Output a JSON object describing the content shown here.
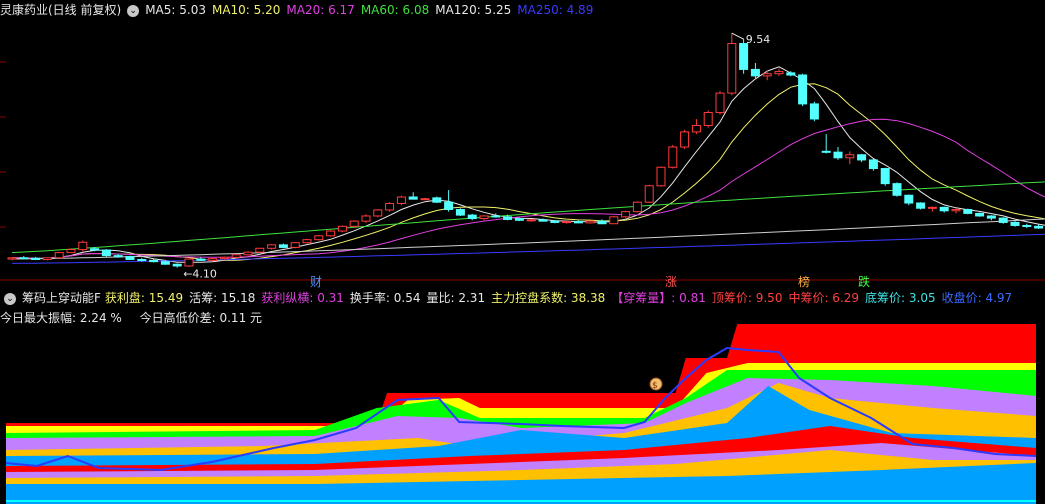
{
  "header": {
    "title": "灵康药业(日线 前复权)",
    "ma": [
      {
        "label": "MA5: 5.03",
        "color": "#e8e8e8"
      },
      {
        "label": "MA10: 5.20",
        "color": "#f2f26a"
      },
      {
        "label": "MA20: 6.17",
        "color": "#e040e0"
      },
      {
        "label": "MA60: 6.08",
        "color": "#40e040"
      },
      {
        "label": "MA120: 5.25",
        "color": "#e8e8e8"
      },
      {
        "label": "MA250: 4.89",
        "color": "#3a3aff"
      }
    ]
  },
  "price_labels": {
    "high": "9.54",
    "low": "4.10"
  },
  "markers": [
    {
      "text": "财",
      "color": "#4f8fff"
    },
    {
      "text": "涨",
      "color": "#ff5050"
    },
    {
      "text": "榜",
      "color": "#ffb040"
    },
    {
      "text": "跌",
      "color": "#40ff40"
    }
  ],
  "indicator": {
    "name": "筹码上穿动能F",
    "items": [
      {
        "label": "获利盘: 15.49",
        "color": "#f2f26a"
      },
      {
        "label": "活筹: 15.18",
        "color": "#e8e8e8"
      },
      {
        "label": "获利纵横: 0.31",
        "color": "#e040e0"
      },
      {
        "label": "换手率: 0.54",
        "color": "#e8e8e8"
      },
      {
        "label": "量比: 2.31",
        "color": "#e8e8e8"
      },
      {
        "label": "主力控盘系数: 38.38",
        "color": "#f2f26a"
      },
      {
        "label": "【穿筹量】: 0.81",
        "color": "#e040e0"
      },
      {
        "label": "顶筹价: 9.50",
        "color": "#ff4040"
      },
      {
        "label": "中筹价: 6.29",
        "color": "#ff4040"
      },
      {
        "label": "底筹价: 3.05",
        "color": "#40e0e0"
      },
      {
        "label": "收盘价: 4.97",
        "color": "#3a6aff"
      }
    ]
  },
  "amplitude": {
    "max_amp": "今日最大振幅: 2.24 %",
    "hl_diff": "今日高低价差: 0.11 元"
  },
  "colors": {
    "up": "#ff3b3b",
    "down": "#54ffff",
    "bg": "#000000",
    "grid": "#8b0000"
  },
  "chart_data": {
    "type": "candlestick",
    "candles": [
      [
        4.3,
        4.34,
        4.27,
        4.33
      ],
      [
        4.33,
        4.37,
        4.3,
        4.32
      ],
      [
        4.32,
        4.35,
        4.28,
        4.29
      ],
      [
        4.29,
        4.34,
        4.27,
        4.33
      ],
      [
        4.33,
        4.47,
        4.32,
        4.45
      ],
      [
        4.45,
        4.55,
        4.44,
        4.52
      ],
      [
        4.52,
        4.73,
        4.48,
        4.69
      ],
      [
        4.54,
        4.58,
        4.48,
        4.51
      ],
      [
        4.51,
        4.53,
        4.35,
        4.38
      ],
      [
        4.38,
        4.42,
        4.33,
        4.36
      ],
      [
        4.36,
        4.38,
        4.28,
        4.29
      ],
      [
        4.29,
        4.33,
        4.24,
        4.27
      ],
      [
        4.27,
        4.31,
        4.22,
        4.24
      ],
      [
        4.24,
        4.26,
        4.17,
        4.18
      ],
      [
        4.18,
        4.2,
        4.1,
        4.14
      ],
      [
        4.14,
        4.32,
        4.12,
        4.3
      ],
      [
        4.3,
        4.34,
        4.26,
        4.27
      ],
      [
        4.27,
        4.33,
        4.25,
        4.31
      ],
      [
        4.31,
        4.36,
        4.29,
        4.34
      ],
      [
        4.34,
        4.41,
        4.32,
        4.4
      ],
      [
        4.4,
        4.48,
        4.38,
        4.46
      ],
      [
        4.46,
        4.56,
        4.44,
        4.55
      ],
      [
        4.55,
        4.64,
        4.52,
        4.63
      ],
      [
        4.63,
        4.66,
        4.55,
        4.57
      ],
      [
        4.57,
        4.69,
        4.55,
        4.68
      ],
      [
        4.68,
        4.77,
        4.66,
        4.75
      ],
      [
        4.75,
        4.86,
        4.73,
        4.84
      ],
      [
        4.84,
        4.97,
        4.82,
        4.95
      ],
      [
        4.95,
        5.08,
        4.92,
        5.06
      ],
      [
        5.06,
        5.2,
        5.03,
        5.18
      ],
      [
        5.18,
        5.34,
        5.14,
        5.3
      ],
      [
        5.3,
        5.46,
        5.27,
        5.44
      ],
      [
        5.44,
        5.62,
        5.4,
        5.59
      ],
      [
        5.59,
        5.77,
        5.55,
        5.74
      ],
      [
        5.74,
        5.85,
        5.68,
        5.69
      ],
      [
        5.69,
        5.72,
        5.67,
        5.7
      ],
      [
        5.72,
        5.75,
        5.6,
        5.62
      ],
      [
        5.62,
        5.9,
        5.4,
        5.45
      ],
      [
        5.45,
        5.48,
        5.3,
        5.32
      ],
      [
        5.32,
        5.35,
        5.2,
        5.24
      ],
      [
        5.24,
        5.32,
        5.2,
        5.3
      ],
      [
        5.3,
        5.36,
        5.26,
        5.28
      ],
      [
        5.28,
        5.33,
        5.2,
        5.22
      ],
      [
        5.24,
        5.26,
        5.18,
        5.2
      ],
      [
        5.2,
        5.23,
        5.17,
        5.21
      ],
      [
        5.21,
        5.24,
        5.17,
        5.18
      ],
      [
        5.18,
        5.2,
        5.13,
        5.15
      ],
      [
        5.15,
        5.18,
        5.12,
        5.17
      ],
      [
        5.17,
        5.2,
        5.13,
        5.14
      ],
      [
        5.14,
        5.19,
        5.12,
        5.18
      ],
      [
        5.18,
        5.22,
        5.11,
        5.12
      ],
      [
        5.12,
        5.3,
        5.12,
        5.28
      ],
      [
        5.28,
        5.42,
        5.26,
        5.4
      ],
      [
        5.4,
        5.64,
        5.38,
        5.62
      ],
      [
        5.62,
        6.02,
        5.6,
        6.0
      ],
      [
        6.0,
        6.45,
        5.98,
        6.43
      ],
      [
        6.43,
        6.95,
        6.4,
        6.9
      ],
      [
        6.9,
        7.3,
        6.85,
        7.25
      ],
      [
        7.25,
        7.55,
        7.2,
        7.4
      ],
      [
        7.4,
        7.75,
        7.35,
        7.7
      ],
      [
        7.7,
        8.2,
        7.65,
        8.15
      ],
      [
        8.15,
        9.54,
        8.1,
        9.3
      ],
      [
        9.3,
        9.4,
        8.6,
        8.7
      ],
      [
        8.7,
        8.85,
        8.5,
        8.55
      ],
      [
        8.55,
        8.68,
        8.45,
        8.6
      ],
      [
        8.6,
        8.72,
        8.55,
        8.65
      ],
      [
        8.62,
        8.66,
        8.54,
        8.57
      ],
      [
        8.57,
        8.6,
        7.85,
        7.9
      ],
      [
        7.9,
        7.95,
        7.5,
        7.55
      ],
      [
        6.8,
        7.2,
        6.75,
        6.78
      ],
      [
        6.78,
        6.9,
        6.6,
        6.65
      ],
      [
        6.65,
        6.8,
        6.5,
        6.72
      ],
      [
        6.72,
        6.74,
        6.55,
        6.6
      ],
      [
        6.6,
        6.62,
        6.35,
        6.4
      ],
      [
        6.4,
        6.42,
        6.0,
        6.05
      ],
      [
        6.05,
        6.08,
        5.75,
        5.78
      ],
      [
        5.78,
        5.8,
        5.55,
        5.6
      ],
      [
        5.6,
        5.62,
        5.45,
        5.48
      ],
      [
        5.48,
        5.52,
        5.4,
        5.5
      ],
      [
        5.5,
        5.52,
        5.38,
        5.42
      ],
      [
        5.42,
        5.48,
        5.36,
        5.45
      ],
      [
        5.45,
        5.47,
        5.34,
        5.36
      ],
      [
        5.36,
        5.38,
        5.28,
        5.3
      ],
      [
        5.3,
        5.32,
        5.2,
        5.25
      ],
      [
        5.25,
        5.27,
        5.12,
        5.15
      ],
      [
        5.15,
        5.18,
        5.05,
        5.08
      ],
      [
        5.08,
        5.12,
        5.02,
        5.06
      ],
      [
        5.06,
        5.1,
        5.0,
        5.02
      ],
      [
        5.02,
        5.06,
        4.97,
        5.0
      ],
      [
        5.0,
        5.04,
        4.96,
        4.97
      ]
    ],
    "ma_lines": [
      "MA5",
      "MA10",
      "MA20",
      "MA60",
      "MA120",
      "MA250"
    ],
    "ylim": [
      4.0,
      9.8
    ]
  }
}
